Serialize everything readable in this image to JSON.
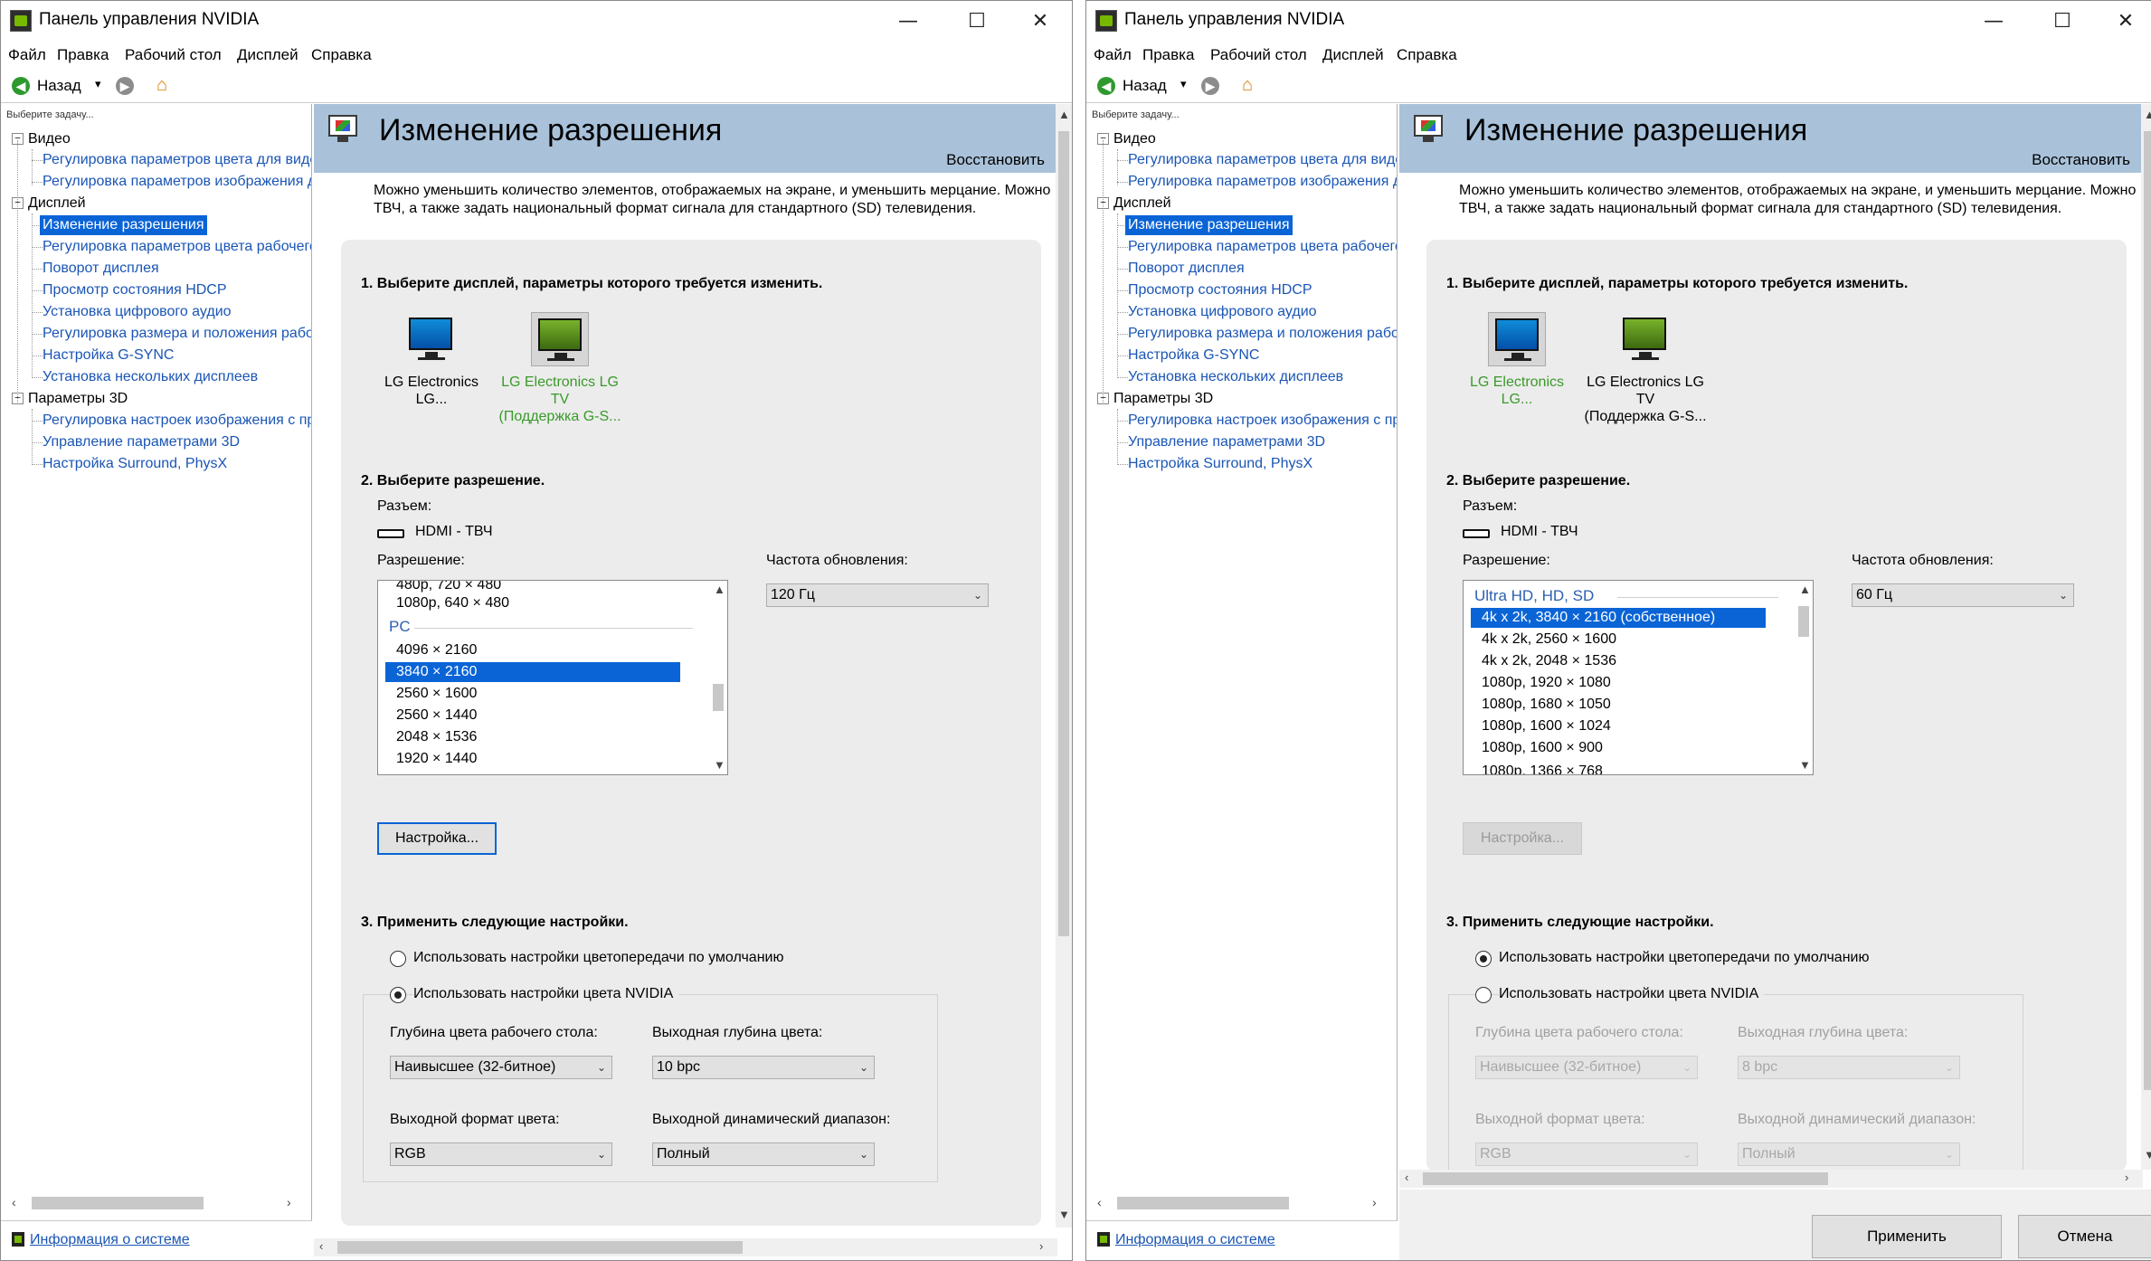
{
  "app": {
    "title": "Панель управления NVIDIA",
    "win_min": "—",
    "win_max": "☐",
    "win_close": "✕"
  },
  "menu": [
    "Файл",
    "Правка",
    "Рабочий стол",
    "Дисплей",
    "Справка"
  ],
  "toolbar": {
    "back_label": "Назад",
    "dropdown": "▾"
  },
  "tree": {
    "task_hint": "Выберите задачу...",
    "groups": [
      {
        "label": "Видео",
        "items": [
          "Регулировка параметров цвета для видео",
          "Регулировка параметров изображения для видео"
        ]
      },
      {
        "label": "Дисплей",
        "items": [
          "Изменение разрешения",
          "Регулировка параметров цвета рабочего стола",
          "Поворот дисплея",
          "Просмотр состояния HDCP",
          "Установка цифрового аудио",
          "Регулировка размера и положения рабочего стола",
          "Настройка G-SYNC",
          "Установка нескольких дисплеев"
        ]
      },
      {
        "label": "Параметры 3D",
        "items": [
          "Регулировка настроек изображения с просмотром",
          "Управление параметрами 3D",
          "Настройка Surround, PhysX"
        ]
      }
    ],
    "system_info": "Информация о системе"
  },
  "page": {
    "title": "Изменение разрешения",
    "restore": "Восстановить",
    "desc_line1": "Можно уменьшить количество элементов, отображаемых на экране, и уменьшить мерцание. Можно",
    "desc_line2": "ТВЧ, а также задать национальный формат сигнала для стандартного (SD) телевидения.",
    "step1": "1. Выберите дисплей, параметры которого требуется изменить.",
    "step2": "2. Выберите разрешение.",
    "step3": "3. Применить следующие настройки.",
    "connector_label": "Разъем:",
    "connector_value": "HDMI - ТВЧ",
    "resolution_label": "Разрешение:",
    "refresh_label": "Частота обновления:",
    "customize": "Настройка...",
    "radio_default": "Использовать настройки цветопередачи по умолчанию",
    "radio_nvidia": "Использовать настройки цвета NVIDIA",
    "desktop_depth_label": "Глубина цвета рабочего стола:",
    "output_depth_label": "Выходная глубина цвета:",
    "output_format_label": "Выходной формат цвета:",
    "output_range_label": "Выходной динамический диапазон:",
    "apply": "Применить",
    "cancel": "Отмена"
  },
  "left": {
    "monitors": [
      {
        "line1": "LG Electronics LG...",
        "line2": ""
      },
      {
        "line1": "LG Electronics LG TV",
        "line2": "(Поддержка G-S..."
      }
    ],
    "res_list": {
      "clipped_top": "480p, 720 × 480",
      "items_top": [
        "1080p, 640 × 480"
      ],
      "group": "PC",
      "items": [
        "4096 × 2160",
        "3840 × 2160",
        "2560 × 1600",
        "2560 × 1440",
        "2048 × 1536",
        "1920 × 1440"
      ],
      "selected": "3840 × 2160"
    },
    "refresh": "120 Гц",
    "desktop_depth": "Наивысшее (32-битное)",
    "output_depth": "10 bpc",
    "output_format": "RGB",
    "output_range": "Полный"
  },
  "right": {
    "monitors": [
      {
        "line1": "LG Electronics LG...",
        "line2": ""
      },
      {
        "line1": "LG Electronics LG TV",
        "line2": "(Поддержка G-S..."
      }
    ],
    "res_list": {
      "group": "Ultra HD, HD, SD",
      "selected": "4k x 2k, 3840 × 2160 (собственное)",
      "items": [
        "4k x 2k, 2560 × 1600",
        "4k x 2k, 2048 × 1536",
        "1080p, 1920 × 1080",
        "1080p, 1680 × 1050",
        "1080p, 1600 × 1024",
        "1080p, 1600 × 900"
      ],
      "clipped_bottom": "1080p, 1366 × 768"
    },
    "refresh": "60 Гц",
    "desktop_depth": "Наивысшее (32-битное)",
    "output_depth": "8 bpc",
    "output_format": "RGB",
    "output_range": "Полный"
  }
}
